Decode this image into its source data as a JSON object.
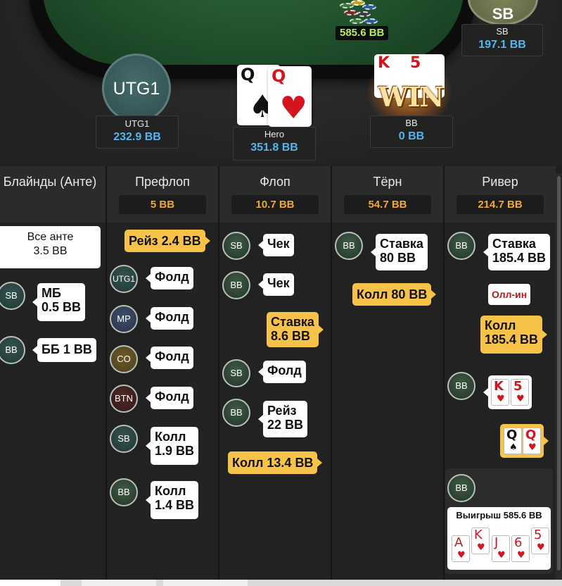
{
  "table": {
    "pot": "585.6 BB",
    "sb": {
      "avatar": "SB",
      "name": "SB",
      "stack": "197.1 BB"
    },
    "utg1": {
      "avatar": "UTG1",
      "name": "UTG1",
      "stack": "232.9 BB"
    },
    "hero": {
      "name": "Hero",
      "stack": "351.8 BB",
      "cards": [
        {
          "rank": "Q",
          "suit": "♠",
          "color": "black"
        },
        {
          "rank": "Q",
          "suit": "♥",
          "color": "red"
        }
      ]
    },
    "bb": {
      "name": "BB",
      "stack": "0 BB",
      "cards": [
        {
          "rank": "K",
          "suit": "♥"
        },
        {
          "rank": "5",
          "suit": "♥"
        }
      ],
      "win_badge": "WIN"
    }
  },
  "streets": [
    {
      "title": "Блайнды (Анте)",
      "pot": ""
    },
    {
      "title": "Префлоп",
      "pot": "5 BB"
    },
    {
      "title": "Флоп",
      "pot": "10.7 BB"
    },
    {
      "title": "Тёрн",
      "pot": "54.7 BB"
    },
    {
      "title": "Ривер",
      "pot": "214.7 BB"
    }
  ],
  "blinds": {
    "ante_text": "Все анте\n3.5 BB",
    "sb_label": "SB",
    "sb_action": "МБ\n0.5 BB",
    "bb_label": "BB",
    "bb_action": "ББ 1 BB"
  },
  "preflop": {
    "hero_action": "Рейз 2.4 BB",
    "rows": [
      {
        "pos": "UTG1",
        "action": "Фолд"
      },
      {
        "pos": "MP",
        "action": "Фолд"
      },
      {
        "pos": "CO",
        "action": "Фолд"
      },
      {
        "pos": "BTN",
        "action": "Фолд"
      },
      {
        "pos": "SB",
        "action": "Колл\n1.9 BB"
      },
      {
        "pos": "BB",
        "action": "Колл\n1.4 BB"
      }
    ]
  },
  "flop": {
    "sb_check_pos": "SB",
    "sb_check": "Чек",
    "bb_check_pos": "BB",
    "bb_check": "Чек",
    "hero_bet": "Ставка\n8.6 BB",
    "sb_fold_pos": "SB",
    "sb_fold": "Фолд",
    "bb_raise_pos": "BB",
    "bb_raise": "Рейз\n22 BB",
    "hero_call": "Колл 13.4 BB"
  },
  "turn": {
    "bb_pos": "BB",
    "bb_bet": "Ставка\n80 BB",
    "hero_call": "Колл 80 BB"
  },
  "river": {
    "bb_pos": "BB",
    "bb_bet": "Ставка\n185.4 BB",
    "allin": "Олл-ин",
    "hero_call": "Колл\n185.4 BB",
    "showdown_pos": "BB",
    "bb_cards": [
      {
        "rank": "K",
        "suit": "♥"
      },
      {
        "rank": "5",
        "suit": "♥"
      }
    ],
    "hero_cards": [
      {
        "rank": "Q",
        "suit": "♠"
      },
      {
        "rank": "Q",
        "suit": "♥"
      }
    ],
    "winner_pos": "BB",
    "winnings": "Выигрыш 585.6 BB",
    "board": [
      {
        "rank": "A",
        "suit": "♥"
      },
      {
        "rank": "K",
        "suit": "♥"
      },
      {
        "rank": "J",
        "suit": "♥"
      },
      {
        "rank": "6",
        "suit": "♥"
      },
      {
        "rank": "5",
        "suit": "♥"
      }
    ]
  },
  "colors": {
    "stack": "#52b7ef",
    "pot": "#b4ec5a",
    "street_pot": "#f0a92e",
    "hero_action": "#f7c248",
    "allin": "#b81a1a"
  }
}
